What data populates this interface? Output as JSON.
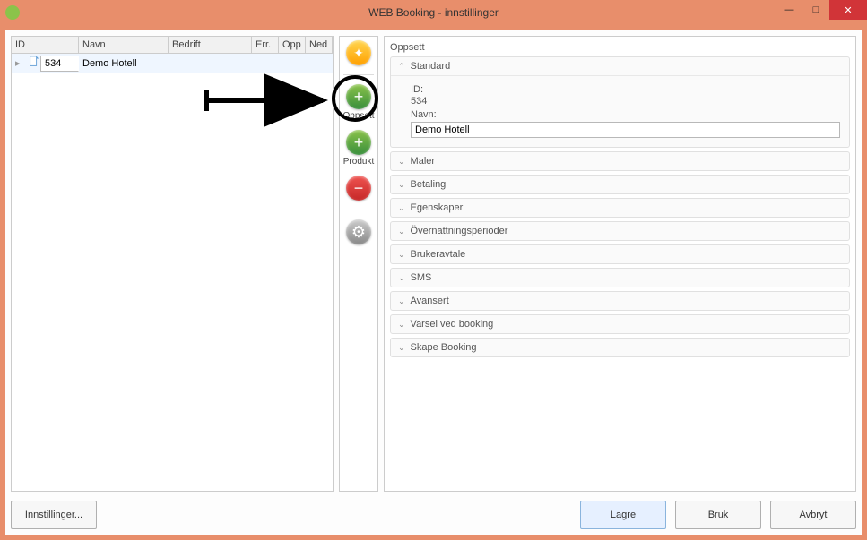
{
  "window": {
    "title": "WEB Booking - innstillinger"
  },
  "grid": {
    "headers": {
      "id": "ID",
      "navn": "Navn",
      "bedrift": "Bedrift",
      "err": "Err.",
      "opp": "Opp",
      "ned": "Ned"
    },
    "rows": [
      {
        "id": "534",
        "navn": "Demo Hotell"
      }
    ]
  },
  "toolbar": {
    "oppsett_label": "Oppsett",
    "produkt_label": "Produkt"
  },
  "right": {
    "title": "Oppsett",
    "standard": {
      "header": "Standard",
      "id_label": "ID:",
      "id_value": "534",
      "navn_label": "Navn:",
      "navn_value": "Demo Hotell"
    },
    "sections": {
      "maler": "Maler",
      "betaling": "Betaling",
      "egenskaper": "Egenskaper",
      "overnattningsperioder": "Övernattningsperioder",
      "brukeravtale": "Brukeravtale",
      "sms": "SMS",
      "avansert": "Avansert",
      "varsel": "Varsel ved booking",
      "skape": "Skape Booking"
    }
  },
  "buttons": {
    "innstillinger": "Innstillinger...",
    "lagre": "Lagre",
    "bruk": "Bruk",
    "avbryt": "Avbryt"
  }
}
